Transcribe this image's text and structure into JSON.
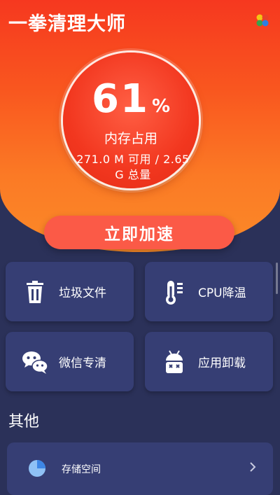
{
  "header": {
    "title": "一拳清理大师"
  },
  "gauge": {
    "value": "61",
    "unit": "%",
    "usage_percent": 61,
    "label": "内存占用",
    "detail_line1": "271.0 M 可用 / 2.65",
    "detail_line2": "G 总量"
  },
  "boost_button": {
    "label": "立即加速"
  },
  "tiles": [
    {
      "label": "垃圾文件",
      "icon": "trash-icon"
    },
    {
      "label": "CPU降温",
      "icon": "thermometer-icon"
    },
    {
      "label": "微信专清",
      "icon": "wechat-icon"
    },
    {
      "label": "应用卸载",
      "icon": "android-icon"
    }
  ],
  "other": {
    "title": "其他",
    "items": [
      {
        "label": "存储空间",
        "icon": "pie-chart-icon"
      }
    ]
  },
  "colors": {
    "hero_top": "#f6381f",
    "hero_bottom": "#fb8a28",
    "background": "#2b3159",
    "tile": "#363e74",
    "button": "#fb5a47"
  }
}
